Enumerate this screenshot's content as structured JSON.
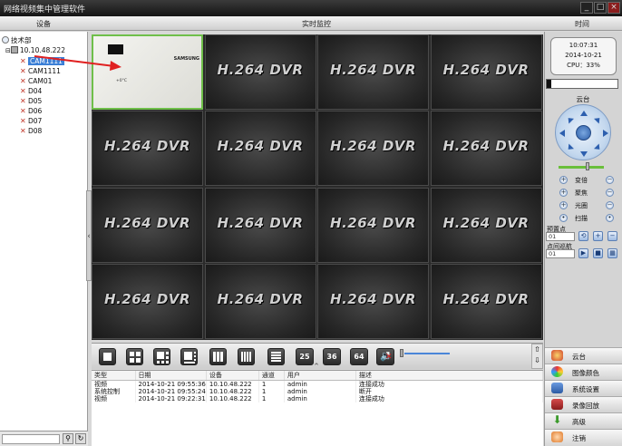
{
  "window": {
    "title": "网络视频集中管理软件",
    "btn_min": "_",
    "btn_max": "□",
    "btn_close": "×"
  },
  "header": {
    "devices": "设备",
    "live": "实时监控",
    "time": "时间"
  },
  "tree": {
    "root": "技术部",
    "ip": "10.10.48.222",
    "cams": [
      "CAM1111",
      "CAM1111",
      "CAM01",
      "D04",
      "D05",
      "D06",
      "D07",
      "D08"
    ]
  },
  "grid": {
    "label": "H.264 DVR",
    "live_text1": "SAMSUNG",
    "live_text2": "+0°C"
  },
  "layout_buttons": [
    "25",
    "36",
    "64"
  ],
  "log": {
    "headers": [
      "类型",
      "日期",
      "设备",
      "通道",
      "用户",
      "描述"
    ],
    "rows": [
      [
        "视频",
        "2014-10-21 09:55:36",
        "10.10.48.222",
        "1",
        "admin",
        "连接成功"
      ],
      [
        "系统控制",
        "2014-10-21 09:55:24",
        "10.10.48.222",
        "1",
        "admin",
        "断开"
      ],
      [
        "视频",
        "2014-10-21 09:22:31",
        "10.10.48.222",
        "1",
        "admin",
        "连接成功"
      ]
    ]
  },
  "clock": {
    "time": "10:07:31",
    "date": "2014-10-21",
    "cpu": "CPU：33%"
  },
  "cpu_fraction": 0.06,
  "ptz": {
    "title": "云台",
    "controls": [
      "变倍",
      "聚焦",
      "光圈",
      "扫描"
    ],
    "preset_label": "预置点",
    "preset_value": "01",
    "cruise_label": "点间巡航",
    "cruise_value": "01"
  },
  "menu": [
    "云台",
    "图像颜色",
    "系统设置",
    "录像回放",
    "高级",
    "注销"
  ],
  "colors": {
    "accent": "#3b7fd6",
    "live_border": "#6fbf4a",
    "arrow": "#e02020"
  }
}
